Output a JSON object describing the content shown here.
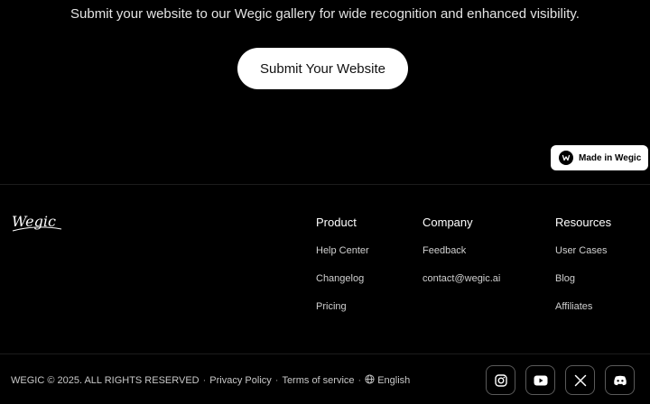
{
  "cta": {
    "tagline": "Submit your website to our Wegic gallery for wide recognition and enhanced visibility.",
    "button_label": "Submit Your Website"
  },
  "badge": {
    "label": "Made in Wegic",
    "icon": "wegic-logo-icon"
  },
  "footer": {
    "logo_text": "Wegic",
    "columns": [
      {
        "title": "Product",
        "links": [
          "Help Center",
          "Changelog",
          "Pricing"
        ]
      },
      {
        "title": "Company",
        "links": [
          "Feedback",
          "contact@wegic.ai"
        ]
      },
      {
        "title": "Resources",
        "links": [
          "User Cases",
          "Blog",
          "Affiliates"
        ]
      }
    ],
    "copyright": "WEGIC © 2025. ALL RIGHTS RESERVED",
    "separator": "·",
    "privacy": "Privacy Policy",
    "terms": "Terms of service",
    "language": "English",
    "social": [
      "instagram-icon",
      "youtube-icon",
      "x-icon",
      "discord-icon"
    ]
  },
  "colors": {
    "background": "#000000",
    "button_bg": "#ffffff",
    "text": "#ffffff",
    "muted_text": "#c8c8c8"
  }
}
